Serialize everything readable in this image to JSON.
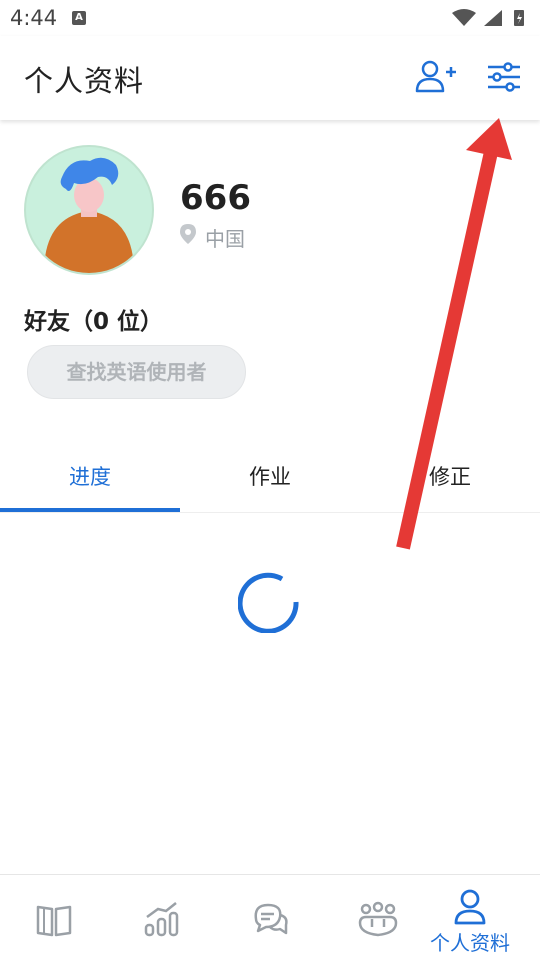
{
  "status_bar": {
    "time": "4:44",
    "notification_icon": "A"
  },
  "header": {
    "title": "个人资料"
  },
  "profile": {
    "username": "666",
    "location": "中国"
  },
  "friends": {
    "title": "好友（0 位）",
    "find_button": "查找英语使用者"
  },
  "tabs": [
    {
      "label": "进度",
      "active": true
    },
    {
      "label": "作业",
      "active": false
    },
    {
      "label": "修正",
      "active": false
    }
  ],
  "bottom_nav": {
    "items": [
      {
        "icon": "book-icon",
        "label": ""
      },
      {
        "icon": "chart-icon",
        "label": ""
      },
      {
        "icon": "chat-icon",
        "label": ""
      },
      {
        "icon": "community-icon",
        "label": ""
      },
      {
        "icon": "profile-icon",
        "label": "个人资料",
        "active": true
      }
    ]
  },
  "colors": {
    "accent": "#1f6fd6",
    "arrow": "#e53935",
    "avatar_bg": "#c9f0dd"
  }
}
